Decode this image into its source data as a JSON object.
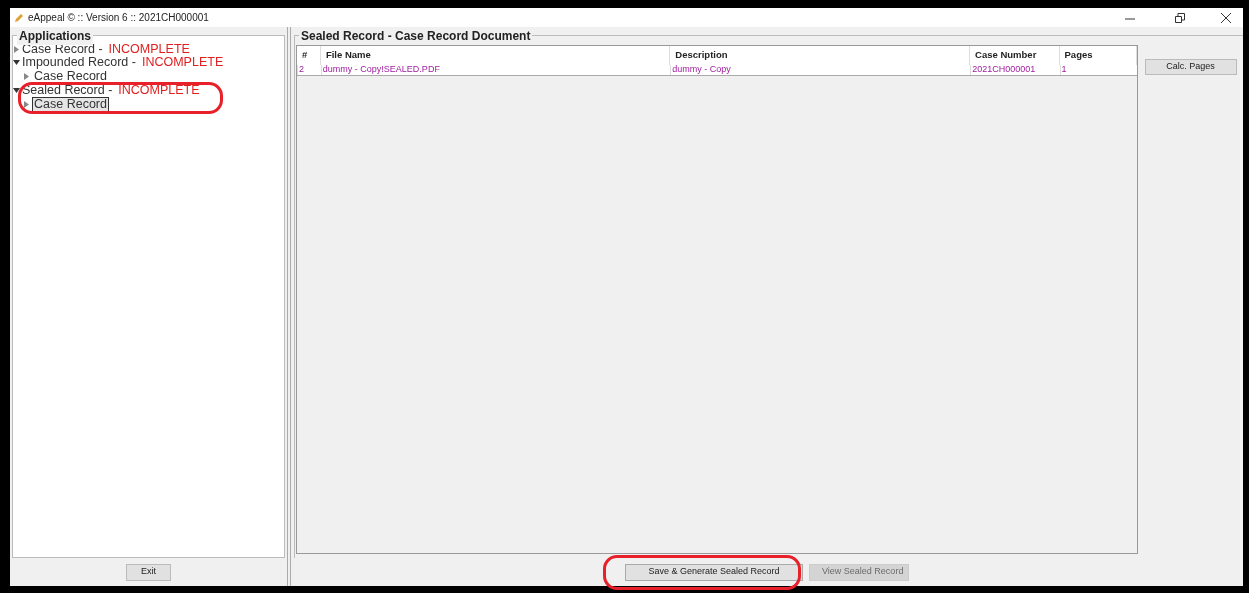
{
  "window": {
    "title": "eAppeal © :: Version 6 :: 2021CH000001"
  },
  "applications": {
    "legend": "Applications",
    "tree": [
      {
        "label": "Case Record -",
        "status": "INCOMPLETE",
        "expanded": false,
        "selected": false
      },
      {
        "label": "Impounded Record -",
        "status": "INCOMPLETE",
        "expanded": true,
        "selected": false,
        "children": [
          {
            "label": "Case Record",
            "expanded": false,
            "selected": false
          }
        ]
      },
      {
        "label": "Sealed Record -",
        "status": "INCOMPLETE",
        "expanded": true,
        "selected": false,
        "children": [
          {
            "label": "Case Record",
            "expanded": false,
            "selected": true
          }
        ]
      }
    ],
    "exit_button": "Exit"
  },
  "document_panel": {
    "legend": "Sealed Record - Case Record Document",
    "table": {
      "columns": [
        "#",
        "File Name",
        "Description",
        "Case Number",
        "Pages"
      ],
      "rows": [
        [
          "2",
          "dummy - Copy!SEALED.PDF",
          "dummy - Copy",
          "2021CH000001",
          "1"
        ]
      ]
    },
    "calc_button": "Calc. Pages",
    "buttons": [
      {
        "label": "Save & Generate Sealed Record",
        "disabled": false
      },
      {
        "label": "View Sealed Record",
        "disabled": true
      }
    ]
  }
}
